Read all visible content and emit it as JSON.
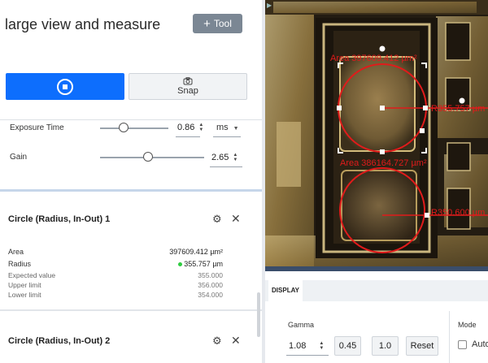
{
  "header": {
    "title": "large view and measure",
    "tool_label": "Tool"
  },
  "capture": {
    "snap_label": "Snap"
  },
  "settings": {
    "exposure": {
      "label": "Exposure Time",
      "value": "0.86",
      "unit": "ms",
      "slider_fraction": 0.35
    },
    "gain": {
      "label": "Gain",
      "value": "2.65",
      "slider_fraction": 0.46
    }
  },
  "measurements": [
    {
      "title": "Circle (Radius, In-Out) 1",
      "area_label": "Area",
      "area_value": "397609.412 µm²",
      "radius_label": "Radius",
      "radius_value": "355.757 µm",
      "expected_label": "Expected value",
      "expected_value": "355.000",
      "upper_label": "Upper limit",
      "upper_value": "356.000",
      "lower_label": "Lower limit",
      "lower_value": "354.000"
    },
    {
      "title": "Circle (Radius, In-Out) 2"
    }
  ],
  "viewer": {
    "annotations": {
      "area1": "Area 397609.412 µm²",
      "radius1": "R355.757 µm",
      "area2": "Area 386164.727 µm²",
      "radius2": "R350.600 µm"
    },
    "measure_color": "#e01b1b"
  },
  "display": {
    "tab_label": "DISPLAY",
    "gamma_label": "Gamma",
    "gamma_value": "1.08",
    "preset1": "0.45",
    "preset2": "1.0",
    "reset_label": "Reset",
    "mode_label": "Mode",
    "auto_label": "Auto"
  },
  "colors": {
    "primary": "#0d6efd",
    "tool_button": "#7b8794",
    "accent_separator": "#c6d6ea"
  }
}
